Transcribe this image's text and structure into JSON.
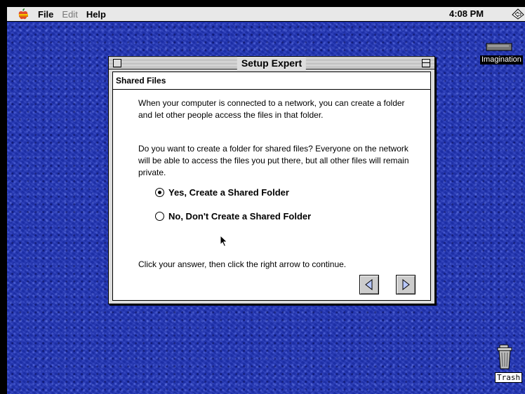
{
  "menubar": {
    "apple_icon": "apple-logo",
    "items": [
      {
        "label": "File",
        "enabled": true
      },
      {
        "label": "Edit",
        "enabled": false
      },
      {
        "label": "Help",
        "enabled": true
      }
    ],
    "clock": "4:08 PM",
    "app_icon": "application-menu-icon"
  },
  "window": {
    "title": "Setup Expert",
    "section_header": "Shared Files",
    "intro_text": "When your computer is connected to a network, you can create a folder and let other people access the files in that folder.",
    "question_text": "Do you want to create a folder for shared files? Everyone on the network will be able to access the files you put there, but all other files will remain private.",
    "options": [
      {
        "label": "Yes, Create a Shared Folder",
        "selected": true
      },
      {
        "label": "No, Don't Create a Shared Folder",
        "selected": false
      }
    ],
    "instruction_text": "Click your answer, then click the right arrow to continue.",
    "nav": {
      "prev_icon": "left-arrow-icon",
      "next_icon": "right-arrow-icon"
    }
  },
  "desktop": {
    "icons": [
      {
        "label": "Imagination",
        "icon": "hard-disk-icon"
      },
      {
        "label": "Trash",
        "icon": "trash-icon"
      }
    ],
    "background_color": "#2034b8"
  }
}
